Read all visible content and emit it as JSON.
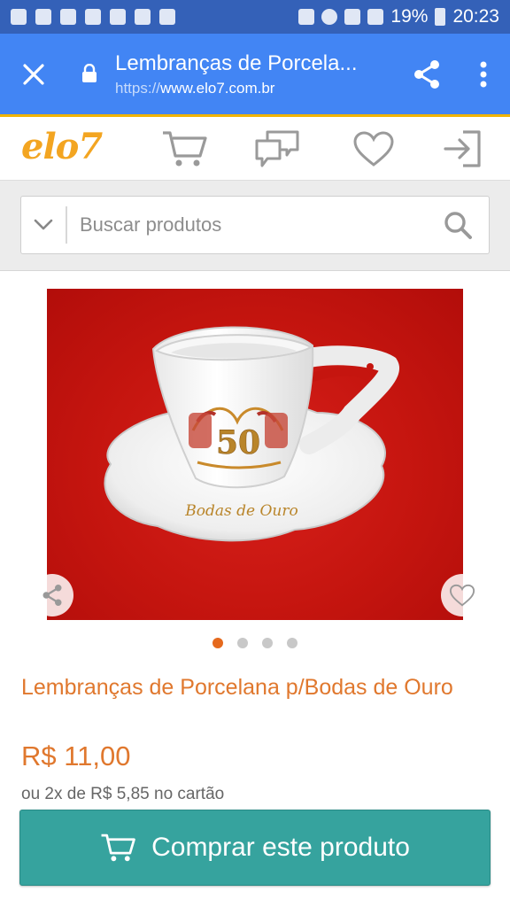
{
  "status_bar": {
    "battery_percent": "19%",
    "time": "20:23"
  },
  "toolbar": {
    "title": "Lembranças de Porcela...",
    "url_scheme": "https://",
    "url_host": "www.elo7.com.br"
  },
  "site": {
    "logo": "elo7"
  },
  "search": {
    "placeholder": "Buscar produtos"
  },
  "product": {
    "title": "Lembranças de Porcelana p/Bodas de Ouro",
    "price": "R$ 11,00",
    "installments": "ou 2x de R$ 5,85 no cartão",
    "image_number_label": "50",
    "image_inscription": "Bodas de Ouro",
    "carousel": {
      "count": 4,
      "active_index": 0
    }
  },
  "buy_button": {
    "label": "Comprar este produto"
  },
  "colors": {
    "toolbar_blue": "#4285f4",
    "brand_orange": "#f3a521",
    "title_orange": "#e0782e",
    "buy_teal": "#36a39e",
    "image_red": "#c5150f"
  },
  "icons": [
    "shield-icon",
    "close-icon",
    "lock-icon",
    "share-icon",
    "more-vert-icon",
    "cart-icon",
    "chat-icon",
    "heart-icon",
    "login-icon",
    "chevron-down-icon",
    "search-icon",
    "wifi-icon",
    "signal-icon",
    "battery-icon",
    "alarm-icon"
  ]
}
